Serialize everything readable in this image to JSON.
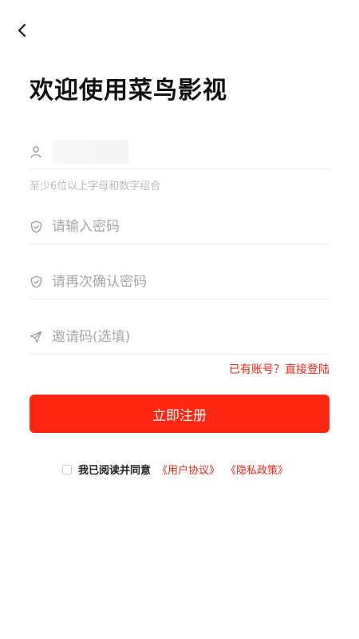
{
  "header": {
    "back_icon": "chevron-left-icon"
  },
  "title": "欢迎使用菜鸟影视",
  "username": {
    "icon": "user-icon",
    "value": "",
    "hint": "至少6位以上字母和数字组合"
  },
  "password": {
    "icon": "shield-icon",
    "placeholder": "请输入密码"
  },
  "confirm_password": {
    "icon": "shield-icon",
    "placeholder": "请再次确认密码"
  },
  "invite_code": {
    "icon": "send-icon",
    "placeholder": "邀请码(选填)"
  },
  "login_link": "已有账号？直接登陆",
  "register_button": "立即注册",
  "agreement": {
    "checked": false,
    "text": "我已阅读并同意",
    "user_agreement": "《用户协议》",
    "privacy_policy": "《隐私政策》"
  },
  "colors": {
    "accent": "#fe2711",
    "link": "#e8261b",
    "placeholder": "#a6a6ab",
    "hint": "#b9b9bf"
  }
}
